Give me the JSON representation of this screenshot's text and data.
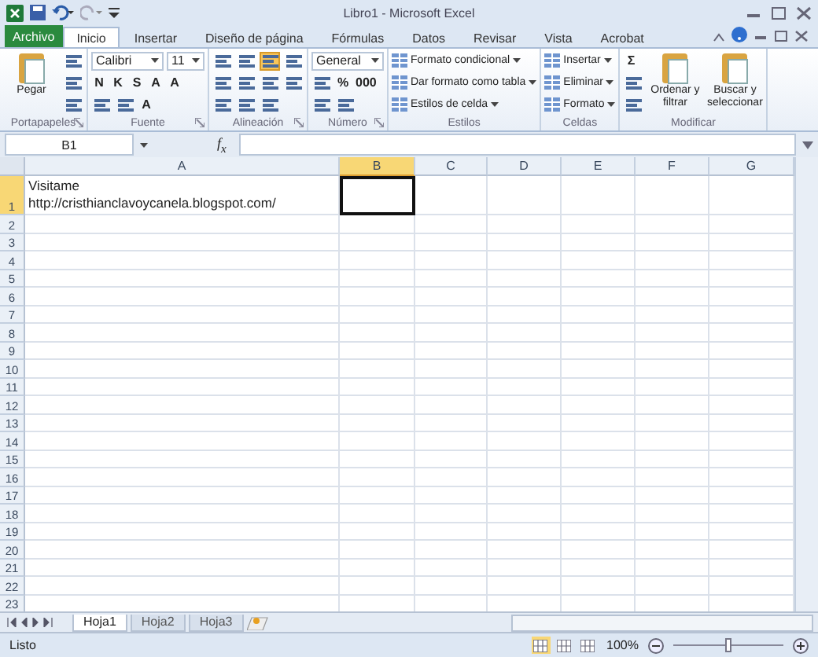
{
  "window": {
    "title": "Libro1  -  Microsoft Excel"
  },
  "tabs": [
    {
      "label": "Archivo",
      "kind": "file",
      "selected": false
    },
    {
      "label": "Inicio",
      "kind": "tab",
      "selected": true
    },
    {
      "label": "Insertar",
      "kind": "tab",
      "selected": false
    },
    {
      "label": "Diseño de página",
      "kind": "tab",
      "selected": false
    },
    {
      "label": "Fórmulas",
      "kind": "tab",
      "selected": false
    },
    {
      "label": "Datos",
      "kind": "tab",
      "selected": false
    },
    {
      "label": "Revisar",
      "kind": "tab",
      "selected": false
    },
    {
      "label": "Vista",
      "kind": "tab",
      "selected": false
    },
    {
      "label": "Acrobat",
      "kind": "tab",
      "selected": false
    }
  ],
  "ribbon": [
    {
      "label": "Portapapeles",
      "launcher": true,
      "blocks": [
        {
          "kind": "big",
          "text": "Pegar"
        },
        {
          "kind": "stack",
          "lines": [
            {
              "items": [
                {
                  "kind": "icon"
                }
              ]
            },
            {
              "items": [
                {
                  "kind": "icon"
                }
              ]
            },
            {
              "items": [
                {
                  "kind": "icon"
                }
              ]
            }
          ]
        }
      ]
    },
    {
      "label": "Fuente",
      "launcher": true,
      "blocks": [
        {
          "kind": "stack",
          "lines": [
            {
              "items": [
                {
                  "kind": "combo",
                  "text": "Calibri"
                },
                {
                  "kind": "spin",
                  "text": "11"
                }
              ]
            },
            {
              "items": [
                {
                  "kind": "glyph",
                  "text": "N"
                },
                {
                  "kind": "glyph",
                  "text": "K"
                },
                {
                  "kind": "glyph",
                  "text": "S"
                },
                {
                  "kind": "glyph",
                  "text": "A"
                },
                {
                  "kind": "glyph",
                  "text": "A"
                }
              ]
            },
            {
              "items": [
                {
                  "kind": "icon"
                },
                {
                  "kind": "icon"
                },
                {
                  "kind": "glyph",
                  "text": "A"
                }
              ]
            }
          ]
        }
      ]
    },
    {
      "label": "Alineación",
      "launcher": true,
      "blocks": [
        {
          "kind": "stack",
          "lines": [
            {
              "items": [
                {
                  "kind": "icon",
                  "selected": false
                },
                {
                  "kind": "icon",
                  "selected": false
                },
                {
                  "kind": "icon",
                  "selected": true
                },
                {
                  "kind": "icon",
                  "selected": false
                }
              ]
            },
            {
              "items": [
                {
                  "kind": "icon"
                },
                {
                  "kind": "icon"
                },
                {
                  "kind": "icon"
                },
                {
                  "kind": "icon"
                }
              ]
            },
            {
              "items": [
                {
                  "kind": "icon"
                },
                {
                  "kind": "icon"
                },
                {
                  "kind": "icon"
                }
              ]
            }
          ]
        }
      ]
    },
    {
      "label": "Número",
      "launcher": true,
      "blocks": [
        {
          "kind": "stack",
          "lines": [
            {
              "items": [
                {
                  "kind": "combo",
                  "text": "General"
                }
              ]
            },
            {
              "items": [
                {
                  "kind": "icon"
                },
                {
                  "kind": "glyph",
                  "text": "%"
                },
                {
                  "kind": "glyph",
                  "text": "000"
                }
              ]
            },
            {
              "items": [
                {
                  "kind": "icon"
                },
                {
                  "kind": "icon"
                }
              ]
            }
          ]
        }
      ]
    },
    {
      "label": "Estilos",
      "launcher": false,
      "blocks": [
        {
          "kind": "stack",
          "lines": [
            {
              "items": [
                {
                  "kind": "text",
                  "text": "Formato condicional"
                }
              ]
            },
            {
              "items": [
                {
                  "kind": "text",
                  "text": "Dar formato como tabla"
                }
              ]
            },
            {
              "items": [
                {
                  "kind": "text",
                  "text": "Estilos de celda"
                }
              ]
            }
          ]
        }
      ]
    },
    {
      "label": "Celdas",
      "launcher": false,
      "blocks": [
        {
          "kind": "stack",
          "lines": [
            {
              "items": [
                {
                  "kind": "text",
                  "text": "Insertar"
                }
              ]
            },
            {
              "items": [
                {
                  "kind": "text",
                  "text": "Eliminar"
                }
              ]
            },
            {
              "items": [
                {
                  "kind": "text",
                  "text": "Formato"
                }
              ]
            }
          ]
        }
      ]
    },
    {
      "label": "Modificar",
      "launcher": false,
      "blocks": [
        {
          "kind": "stack",
          "lines": [
            {
              "items": [
                {
                  "kind": "glyph",
                  "text": "Σ"
                }
              ]
            },
            {
              "items": [
                {
                  "kind": "icon"
                }
              ]
            },
            {
              "items": [
                {
                  "kind": "icon"
                }
              ]
            }
          ]
        },
        {
          "kind": "big",
          "text": "Ordenar y filtrar"
        },
        {
          "kind": "big",
          "text": "Buscar y seleccionar"
        }
      ]
    }
  ],
  "formula_bar": {
    "name_box": "B1",
    "function_label": "f$_{x}$"
  },
  "columns": [
    {
      "label": "A",
      "selected": false
    },
    {
      "label": "B",
      "selected": true
    },
    {
      "label": "C",
      "selected": false
    },
    {
      "label": "D",
      "selected": false
    },
    {
      "label": "E",
      "selected": false
    },
    {
      "label": "F",
      "selected": false
    },
    {
      "label": "G",
      "selected": false
    }
  ],
  "rows": [
    {
      "label": "1",
      "selected": true,
      "cells": [
        {
          "text": "Visitame\nhttp://cristhianclavoycanela.blogspot.com/",
          "active": false
        },
        {
          "active": true
        }
      ]
    },
    {
      "label": "2",
      "selected": false
    },
    {
      "label": "3",
      "selected": false
    },
    {
      "label": "4",
      "selected": false
    },
    {
      "label": "5",
      "selected": false
    },
    {
      "label": "6",
      "selected": false
    },
    {
      "label": "7",
      "selected": false
    },
    {
      "label": "8",
      "selected": false
    },
    {
      "label": "9",
      "selected": false
    },
    {
      "label": "10",
      "selected": false
    },
    {
      "label": "11",
      "selected": false
    },
    {
      "label": "12",
      "selected": false
    },
    {
      "label": "13",
      "selected": false
    },
    {
      "label": "14",
      "selected": false
    },
    {
      "label": "15",
      "selected": false
    },
    {
      "label": "16",
      "selected": false
    },
    {
      "label": "17",
      "selected": false
    },
    {
      "label": "18",
      "selected": false
    },
    {
      "label": "19",
      "selected": false
    },
    {
      "label": "20",
      "selected": false
    },
    {
      "label": "21",
      "selected": false
    },
    {
      "label": "22",
      "selected": false
    },
    {
      "label": "23",
      "selected": false
    }
  ],
  "sheets": [
    {
      "label": "Hoja1",
      "selected": true
    },
    {
      "label": "Hoja2",
      "selected": false
    },
    {
      "label": "Hoja3",
      "selected": false
    }
  ],
  "status_bar": {
    "text": "Listo",
    "views": [
      {
        "selected": true
      },
      {
        "selected": false
      },
      {
        "selected": false
      }
    ],
    "zoom": "100%",
    "zoom_slider": {
      "level": 0.5
    }
  }
}
